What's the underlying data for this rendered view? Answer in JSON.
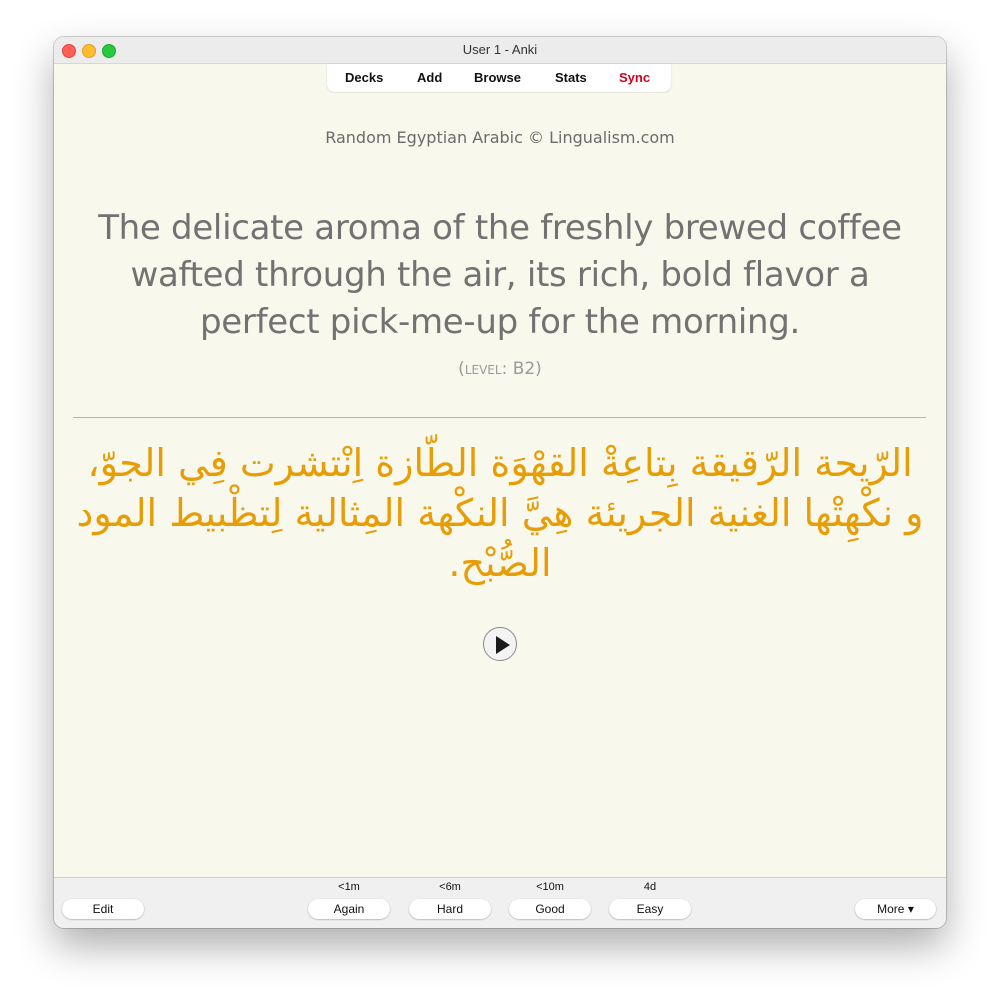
{
  "window": {
    "title": "User 1 - Anki"
  },
  "toolbar": {
    "decks": "Decks",
    "add": "Add",
    "browse": "Browse",
    "stats": "Stats",
    "sync": "Sync",
    "sync_color": "#d0021b"
  },
  "card": {
    "deck_title": "Random Egyptian Arabic © Lingualism.com",
    "english_sentence": "The delicate aroma of the freshly brewed coffee wafted through the air, its rich, bold flavor a perfect pick-me-up for the morning.",
    "level_open": "(",
    "level_word": "level",
    "level_value": ": B2)",
    "arabic_sentence": "الرّيحة الرّقيقة بِتاعِةْ القهْوَة الطّازة اِنْتشرت فِي الجوّ، و نكْهِتْها الغنية الجريئة هِيَّ النكْهة المِثالية لِتظْبيط المود الصُّبْح.",
    "arabic_color": "#e79d06",
    "audio_icon": "play-icon"
  },
  "answer_bar": {
    "edit": "Edit",
    "more": "More ▾",
    "buttons": [
      {
        "interval": "<1m",
        "label": "Again"
      },
      {
        "interval": "<6m",
        "label": "Hard"
      },
      {
        "interval": "<10m",
        "label": "Good"
      },
      {
        "interval": "4d",
        "label": "Easy"
      }
    ]
  }
}
